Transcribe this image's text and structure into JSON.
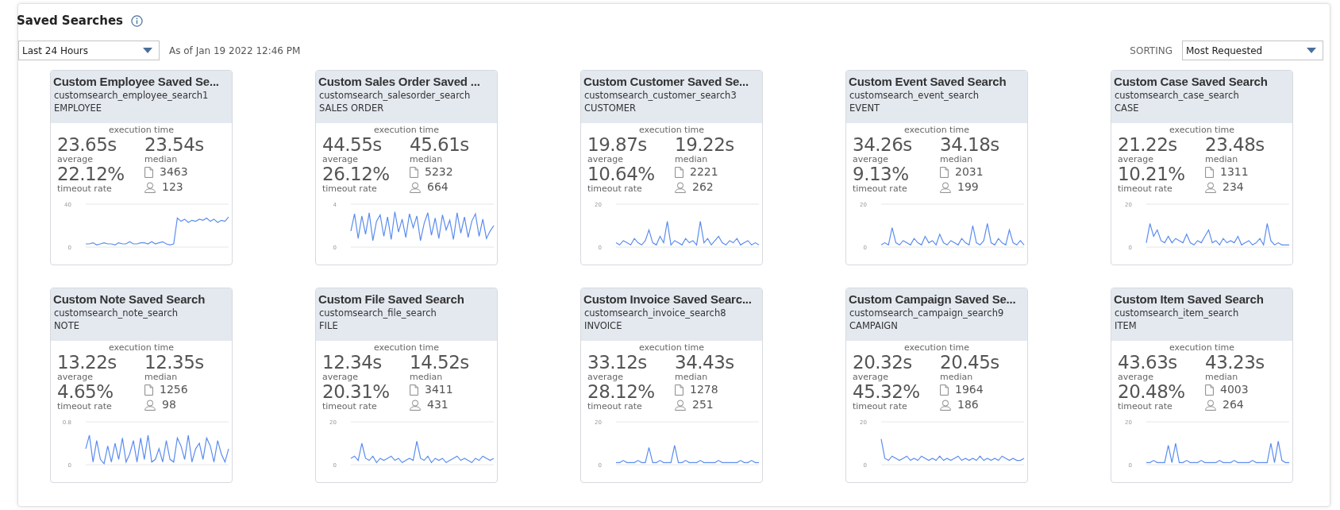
{
  "title": "Saved Searches",
  "range_select": {
    "value": "Last 24 Hours"
  },
  "as_of": "As of Jan 19 2022 12:46 PM",
  "sorting": {
    "label": "SORTING",
    "value": "Most Requested"
  },
  "cards": [
    {
      "title": "Custom Employee Saved Se...",
      "search_id": "customsearch_employee_search1",
      "record_type": "EMPLOYEE",
      "metric_label": "execution time",
      "average": "23.65s",
      "average_label": "average",
      "median": "23.54s",
      "median_label": "median",
      "timeout_rate": "22.12%",
      "timeout_label": "timeout rate",
      "results": "3463",
      "users": "123",
      "chart_data": {
        "type": "line",
        "ylim": [
          0,
          40
        ],
        "yticks": [
          0,
          40
        ],
        "series": [
          {
            "color": "#5b8def",
            "values": [
              3,
              3,
              4,
              2,
              3,
              4,
              3,
              3,
              2,
              4,
              3,
              3,
              5,
              3,
              3,
              4,
              4,
              3,
              5,
              3,
              4,
              5,
              3,
              2,
              3,
              27,
              24,
              26,
              23,
              25,
              24,
              26,
              25,
              27,
              24,
              26,
              23,
              25,
              24,
              28
            ]
          }
        ]
      }
    },
    {
      "title": "Custom Sales Order Saved ...",
      "search_id": "customsearch_salesorder_search",
      "record_type": "SALES ORDER",
      "metric_label": "execution time",
      "average": "44.55s",
      "average_label": "average",
      "median": "45.61s",
      "median_label": "median",
      "timeout_rate": "26.12%",
      "timeout_label": "timeout rate",
      "results": "5232",
      "users": "664",
      "chart_data": {
        "type": "line",
        "ylim": [
          0,
          4
        ],
        "yticks": [
          0,
          4
        ],
        "series": [
          {
            "color": "#5b8def",
            "values": [
              1.5,
              3.1,
              0.8,
              2.9,
              1.2,
              3.2,
              0.6,
              2.4,
              3.0,
              1.0,
              2.8,
              0.7,
              3.3,
              1.4,
              2.6,
              0.9,
              3.1,
              1.8,
              2.9,
              0.6,
              2.2,
              3.2,
              1.1,
              2.7,
              0.8,
              3.0,
              1.6,
              2.5,
              0.7,
              3.2,
              1.3,
              2.8,
              0.9,
              2.4,
              3.1,
              1.0,
              2.6,
              0.8,
              1.5,
              2.0
            ]
          }
        ]
      }
    },
    {
      "title": "Custom Customer Saved Se...",
      "search_id": "customsearch_customer_search3",
      "record_type": "CUSTOMER",
      "metric_label": "execution time",
      "average": "19.87s",
      "average_label": "average",
      "median": "19.22s",
      "median_label": "median",
      "timeout_rate": "10.64%",
      "timeout_label": "timeout rate",
      "results": "2221",
      "users": "262",
      "chart_data": {
        "type": "line",
        "ylim": [
          0,
          20
        ],
        "yticks": [
          0,
          20
        ],
        "series": [
          {
            "color": "#5b8def",
            "values": [
              2,
              1,
              3,
              2,
              1,
              4,
              2,
              1,
              3,
              8,
              2,
              1,
              5,
              2,
              12,
              1,
              3,
              2,
              1,
              4,
              2,
              3,
              1,
              12,
              2,
              4,
              1,
              3,
              5,
              2,
              1,
              3,
              2,
              4,
              1,
              2,
              3,
              1,
              2,
              1
            ]
          }
        ]
      }
    },
    {
      "title": "Custom Event Saved Search",
      "search_id": "customsearch_event_search",
      "record_type": "EVENT",
      "metric_label": "execution time",
      "average": "34.26s",
      "average_label": "average",
      "median": "34.18s",
      "median_label": "median",
      "timeout_rate": "9.13%",
      "timeout_label": "timeout rate",
      "results": "2031",
      "users": "199",
      "chart_data": {
        "type": "line",
        "ylim": [
          0,
          20
        ],
        "yticks": [
          0,
          20
        ],
        "series": [
          {
            "color": "#5b8def",
            "values": [
              1,
              2,
              1,
              9,
              2,
              1,
              3,
              2,
              1,
              4,
              2,
              1,
              5,
              2,
              3,
              1,
              6,
              2,
              1,
              3,
              2,
              1,
              4,
              2,
              1,
              10,
              2,
              1,
              3,
              11,
              2,
              1,
              4,
              2,
              1,
              8,
              2,
              1,
              3,
              1
            ]
          }
        ]
      }
    },
    {
      "title": "Custom Case Saved Search",
      "search_id": "customsearch_case_search",
      "record_type": "CASE",
      "metric_label": "execution time",
      "average": "21.22s",
      "average_label": "average",
      "median": "23.48s",
      "median_label": "median",
      "timeout_rate": "10.21%",
      "timeout_label": "timeout rate",
      "results": "1311",
      "users": "234",
      "chart_data": {
        "type": "line",
        "ylim": [
          0,
          20
        ],
        "yticks": [
          0,
          20
        ],
        "series": [
          {
            "color": "#5b8def",
            "values": [
              2,
              11,
              5,
              8,
              3,
              2,
              5,
              2,
              4,
              3,
              2,
              6,
              2,
              1,
              3,
              2,
              5,
              8,
              2,
              3,
              1,
              4,
              2,
              3,
              2,
              5,
              1,
              2,
              3,
              1,
              2,
              4,
              1,
              11,
              3,
              1,
              2,
              1,
              1,
              1
            ]
          }
        ]
      }
    },
    {
      "title": "Custom Note Saved Search",
      "search_id": "customsearch_note_search",
      "record_type": "NOTE",
      "metric_label": "execution time",
      "average": "13.22s",
      "average_label": "average",
      "median": "12.35s",
      "median_label": "median",
      "timeout_rate": "4.65%",
      "timeout_label": "timeout rate",
      "results": "1256",
      "users": "98",
      "chart_data": {
        "type": "line",
        "ylim": [
          0,
          0.8
        ],
        "yticks": [
          0,
          0.8
        ],
        "series": [
          {
            "color": "#5b8def",
            "values": [
              0.3,
              0.55,
              0.05,
              0.45,
              0.1,
              0.02,
              0.35,
              0.05,
              0.4,
              0.1,
              0.5,
              0.05,
              0.2,
              0.45,
              0.05,
              0.5,
              0.1,
              0.55,
              0.05,
              0.1,
              0.3,
              0.05,
              0.45,
              0.1,
              0.05,
              0.5,
              0.35,
              0.1,
              0.55,
              0.05,
              0.3,
              0.4,
              0.1,
              0.5,
              0.35,
              0.05,
              0.45,
              0.2,
              0.05,
              0.3
            ]
          }
        ]
      }
    },
    {
      "title": "Custom File Saved Search",
      "search_id": "customsearch_file_search",
      "record_type": "FILE",
      "metric_label": "execution time",
      "average": "12.34s",
      "average_label": "average",
      "median": "14.52s",
      "median_label": "median",
      "timeout_rate": "20.31%",
      "timeout_label": "timeout rate",
      "results": "3411",
      "users": "431",
      "chart_data": {
        "type": "line",
        "ylim": [
          0,
          20
        ],
        "yticks": [
          0,
          20
        ],
        "series": [
          {
            "color": "#5b8def",
            "values": [
              3,
              4,
              2,
              10,
              3,
              2,
              4,
              1,
              3,
              2,
              3,
              4,
              2,
              3,
              1,
              2,
              3,
              2,
              11,
              3,
              2,
              4,
              1,
              3,
              2,
              3,
              1,
              2,
              3,
              4,
              2,
              3,
              2,
              1,
              3,
              2,
              4,
              3,
              2,
              3
            ]
          }
        ]
      }
    },
    {
      "title": "Custom Invoice Saved Searc...",
      "search_id": "customsearch_invoice_search8",
      "record_type": "INVOICE",
      "metric_label": "execution time",
      "average": "33.12s",
      "average_label": "average",
      "median": "34.43s",
      "median_label": "median",
      "timeout_rate": "28.12%",
      "timeout_label": "timeout rate",
      "results": "1278",
      "users": "251",
      "chart_data": {
        "type": "line",
        "ylim": [
          0,
          20
        ],
        "yticks": [
          0,
          20
        ],
        "series": [
          {
            "color": "#5b8def",
            "values": [
              1,
              1,
              2,
              1,
              1,
              1,
              2,
              1,
              1,
              8,
              1,
              1,
              2,
              1,
              1,
              1,
              9,
              1,
              1,
              2,
              1,
              1,
              1,
              2,
              1,
              1,
              1,
              1,
              2,
              1,
              1,
              1,
              1,
              1,
              2,
              1,
              1,
              2,
              1,
              1
            ]
          }
        ]
      }
    },
    {
      "title": "Custom Campaign Saved Se...",
      "search_id": "customsearch_campaign_search9",
      "record_type": "CAMPAIGN",
      "metric_label": "execution time",
      "average": "20.32s",
      "average_label": "average",
      "median": "20.45s",
      "median_label": "median",
      "timeout_rate": "45.32%",
      "timeout_label": "timeout rate",
      "results": "1964",
      "users": "186",
      "chart_data": {
        "type": "line",
        "ylim": [
          0,
          20
        ],
        "yticks": [
          0,
          20
        ],
        "series": [
          {
            "color": "#5b8def",
            "values": [
              12,
              3,
              2,
              4,
              3,
              2,
              3,
              4,
              2,
              3,
              2,
              4,
              3,
              2,
              3,
              2,
              4,
              2,
              3,
              2,
              3,
              4,
              2,
              3,
              2,
              3,
              2,
              4,
              2,
              3,
              2,
              3,
              2,
              4,
              3,
              2,
              3,
              2,
              2,
              3
            ]
          }
        ]
      }
    },
    {
      "title": "Custom Item Saved Search",
      "search_id": "customsearch_item_search",
      "record_type": "ITEM",
      "metric_label": "execution time",
      "average": "43.63s",
      "average_label": "average",
      "median": "43.23s",
      "median_label": "median",
      "timeout_rate": "20.48%",
      "timeout_label": "timeout rate",
      "results": "4003",
      "users": "264",
      "chart_data": {
        "type": "line",
        "ylim": [
          0,
          20
        ],
        "yticks": [
          0,
          20
        ],
        "series": [
          {
            "color": "#5b8def",
            "values": [
              1,
              1,
              2,
              1,
              1,
              1,
              9,
              1,
              10,
              1,
              1,
              2,
              1,
              1,
              1,
              2,
              1,
              1,
              1,
              1,
              2,
              1,
              1,
              1,
              2,
              1,
              1,
              1,
              1,
              2,
              1,
              1,
              1,
              1,
              10,
              1,
              11,
              2,
              1,
              1
            ]
          }
        ]
      }
    }
  ]
}
